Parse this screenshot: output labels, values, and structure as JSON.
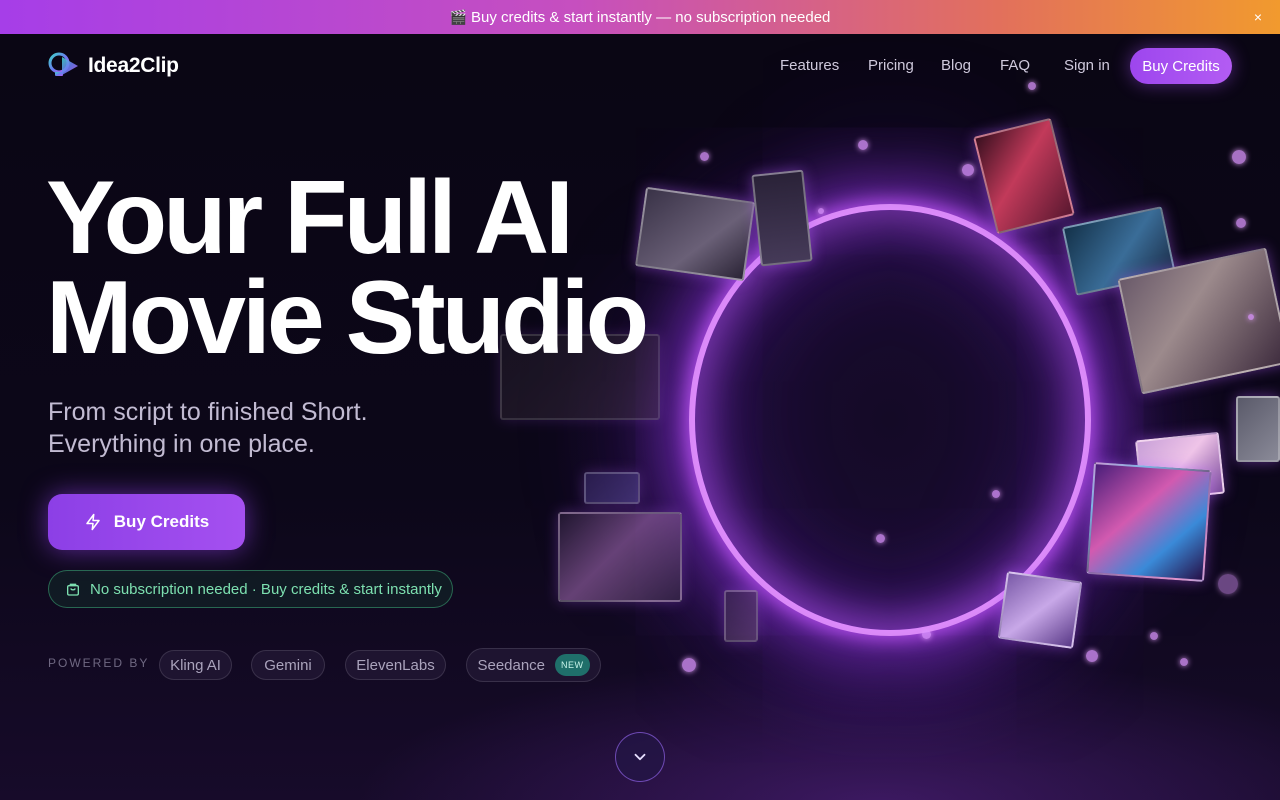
{
  "promo": {
    "emoji": "🎬",
    "text": "Buy credits & start instantly — no subscription needed",
    "close_glyph": "×"
  },
  "nav": {
    "brand": "Idea2Clip",
    "links": [
      "Features",
      "Pricing",
      "Blog",
      "FAQ"
    ],
    "signin": "Sign in",
    "cta": "Buy Credits"
  },
  "hero": {
    "headline_line1": "Your Full AI",
    "headline_line2": "Movie Studio",
    "sub_line1": "From script to finished Short.",
    "sub_line2": "Everything in one place.",
    "cta_label": "Buy Credits",
    "notice": "No subscription needed · Buy credits & start instantly"
  },
  "powered": {
    "label": "POWERED BY",
    "providers": [
      "Kling AI",
      "Gemini",
      "ElevenLabs",
      "Seedance"
    ],
    "new_badge": "NEW"
  },
  "icons": {
    "logo": "play-bulb-icon",
    "cta": "lightning-icon",
    "notice": "shopping-bag-icon",
    "scroll": "chevron-down-icon",
    "close": "close-icon"
  },
  "colors": {
    "accent": "#9d46ee",
    "promo_gradient_start": "#a63ee8",
    "promo_gradient_end": "#f19a2e",
    "notice_text": "#7de0b0",
    "background": "#0b0716"
  }
}
